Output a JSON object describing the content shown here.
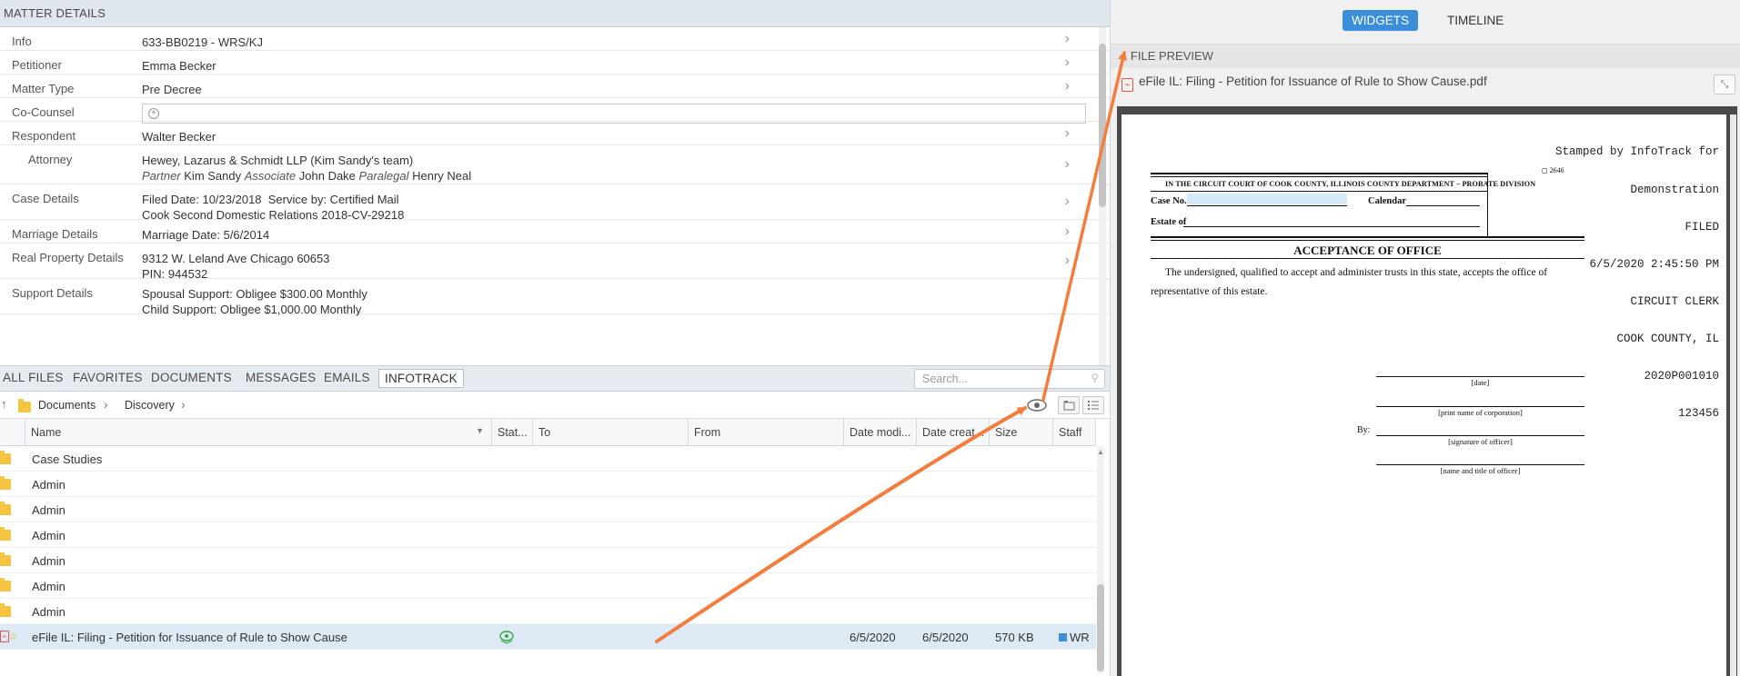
{
  "matter": {
    "section_title": "MATTER DETAILS",
    "rows": [
      {
        "label": "Info",
        "lines": [
          "633-BB0219 - WRS/KJ"
        ]
      },
      {
        "label": "Petitioner",
        "lines": [
          "Emma Becker"
        ]
      },
      {
        "label": "Matter Type",
        "lines": [
          "Pre Decree"
        ]
      },
      {
        "label": "Co-Counsel",
        "lines": []
      },
      {
        "label": "Respondent",
        "lines": [
          "Walter Becker"
        ]
      },
      {
        "label": "Attorney",
        "lines": [
          "Hewey, Lazarus & Schmidt LLP (Kim Sandy's team)"
        ],
        "roles": [
          {
            "role": "Partner",
            "name": "Kim Sandy"
          },
          {
            "role": "Associate",
            "name": "John Dake"
          },
          {
            "role": "Paralegal",
            "name": "Henry Neal"
          }
        ]
      },
      {
        "label": "Case Details",
        "lines": [
          "Filed Date: 10/23/2018  Service by: Certified Mail",
          "Cook Second Domestic Relations 2018-CV-29218"
        ]
      },
      {
        "label": "Marriage Details",
        "lines": [
          "Marriage Date: 5/6/2014"
        ]
      },
      {
        "label": "Real Property Details",
        "lines": [
          "9312 W. Leland Ave Chicago 60653",
          "PIN: 944532"
        ]
      },
      {
        "label": "Support Details",
        "lines": [
          "Spousal Support: Obligee $300.00 Monthly",
          "Child Support: Obligee $1,000.00 Monthly"
        ]
      }
    ]
  },
  "files": {
    "tabs": [
      "ALL FILES",
      "FAVORITES",
      "DOCUMENTS",
      "MESSAGES",
      "EMAILS",
      "INFOTRACK"
    ],
    "active_tab": "INFOTRACK",
    "search_placeholder": "Search...",
    "breadcrumb": [
      "Documents",
      "Discovery"
    ],
    "columns": [
      "Name",
      "Stat...",
      "To",
      "From",
      "Date modi...",
      "Date creat...",
      "Size",
      "Staff"
    ],
    "folders": [
      "Case Studies",
      "Admin",
      "Admin",
      "Admin",
      "Admin",
      "Admin",
      "Admin"
    ],
    "file": {
      "name": "eFile IL: Filing - Petition for Issuance of Rule to Show Cause",
      "date_modified": "6/5/2020",
      "date_created": "6/5/2020",
      "size": "570 KB",
      "staff": "WR"
    }
  },
  "right": {
    "tabs": [
      "WIDGETS",
      "TIMELINE"
    ],
    "active_tab": "WIDGETS",
    "preview_header": "FILE PREVIEW",
    "file_title": "eFile IL: Filing - Petition for Issuance of Rule to Show Cause.pdf"
  },
  "pdf": {
    "stamp_lines": [
      "Stamped by InfoTrack for",
      "Demonstration",
      "FILED",
      "6/5/2020 2:45:50 PM",
      "CIRCUIT CLERK",
      "COOK COUNTY, IL",
      "2020P001010",
      "123456"
    ],
    "form_number": "2646",
    "court_heading": "IN THE CIRCUIT COURT OF COOK COUNTY, ILLINOIS COUNTY DEPARTMENT – PROBATE DIVISION",
    "case_no_label": "Case No.",
    "calendar_label": "Calendar",
    "estate_label": "Estate of",
    "title": "ACCEPTANCE OF OFFICE",
    "body": "The undersigned, qualified to accept and administer trusts in this state, accepts the office of representative of this estate.",
    "sig_labels": [
      "[date]",
      "[print name of corporation]",
      "[signature of officer]",
      "[name and title of officer]"
    ],
    "by_label": "By:"
  },
  "colors": {
    "accent": "#3b8fd8",
    "annotation_arrow": "#f47c3c",
    "selected_row": "#dde9f5",
    "folder": "#f5c542"
  },
  "icons": [
    "chevron-right-icon",
    "plus-circle-icon",
    "search-icon",
    "up-arrow-icon",
    "folder-icon",
    "eye-icon",
    "folder-view-icon",
    "list-view-icon",
    "pdf-file-icon",
    "star-icon",
    "sync-status-icon",
    "collapse-icon",
    "triangle-down-icon"
  ]
}
